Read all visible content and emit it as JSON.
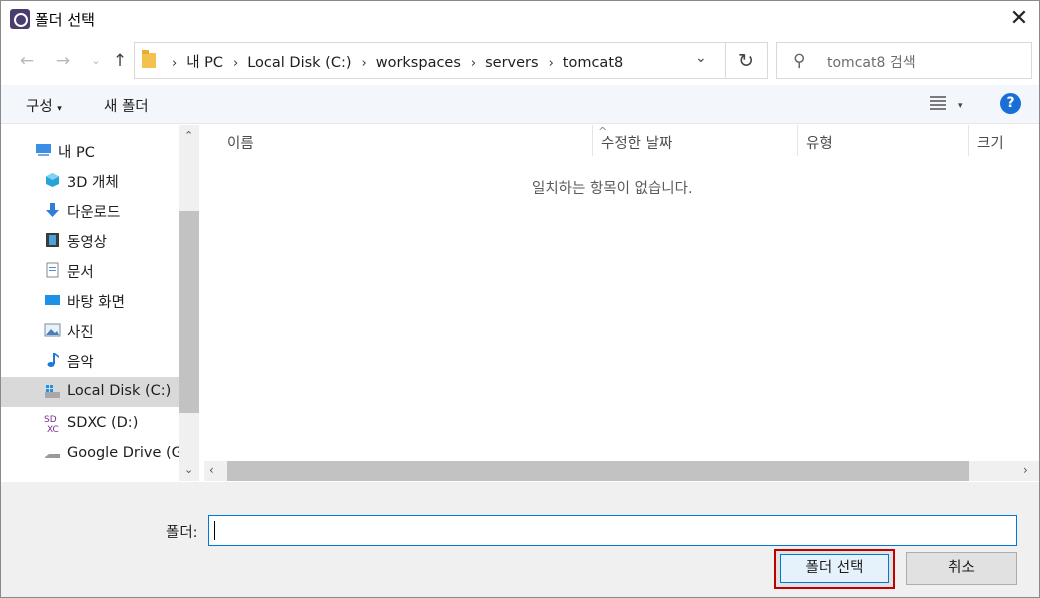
{
  "window": {
    "title": "폴더 선택"
  },
  "address": {
    "crumbs": [
      "내 PC",
      "Local Disk (C:)",
      "workspaces",
      "servers",
      "tomcat8"
    ]
  },
  "search": {
    "placeholder": "tomcat8 검색"
  },
  "toolbar": {
    "organize": "구성",
    "new_folder": "새 폴더"
  },
  "nav": {
    "items": [
      {
        "label": "내 PC",
        "icon": "pc-icon",
        "selected": false
      },
      {
        "label": "3D 개체",
        "icon": "cube-3d-icon",
        "selected": false
      },
      {
        "label": "다운로드",
        "icon": "download-arrow-icon",
        "selected": false
      },
      {
        "label": "동영상",
        "icon": "video-film-icon",
        "selected": false
      },
      {
        "label": "문서",
        "icon": "document-icon",
        "selected": false
      },
      {
        "label": "바탕 화면",
        "icon": "desktop-icon",
        "selected": false
      },
      {
        "label": "사진",
        "icon": "picture-icon",
        "selected": false
      },
      {
        "label": "음악",
        "icon": "music-note-icon",
        "selected": false
      },
      {
        "label": "Local Disk (C:)",
        "icon": "drive-windows-icon",
        "selected": true
      },
      {
        "label": "SDXC (D:)",
        "icon": "sd-card-icon",
        "selected": false
      },
      {
        "label": "Google Drive (G:",
        "icon": "drive-icon",
        "selected": false
      }
    ]
  },
  "columns": {
    "name": "이름",
    "modified": "수정한 날짜",
    "type": "유형",
    "size": "크기"
  },
  "empty_message": "일치하는 항목이 없습니다.",
  "footer": {
    "folder_label": "폴더:",
    "folder_value": "",
    "select_button": "폴더 선택",
    "cancel_button": "취소"
  },
  "colors": {
    "accent": "#0078d7",
    "highlight_border": "#c00000",
    "help": "#1a6fd6"
  }
}
